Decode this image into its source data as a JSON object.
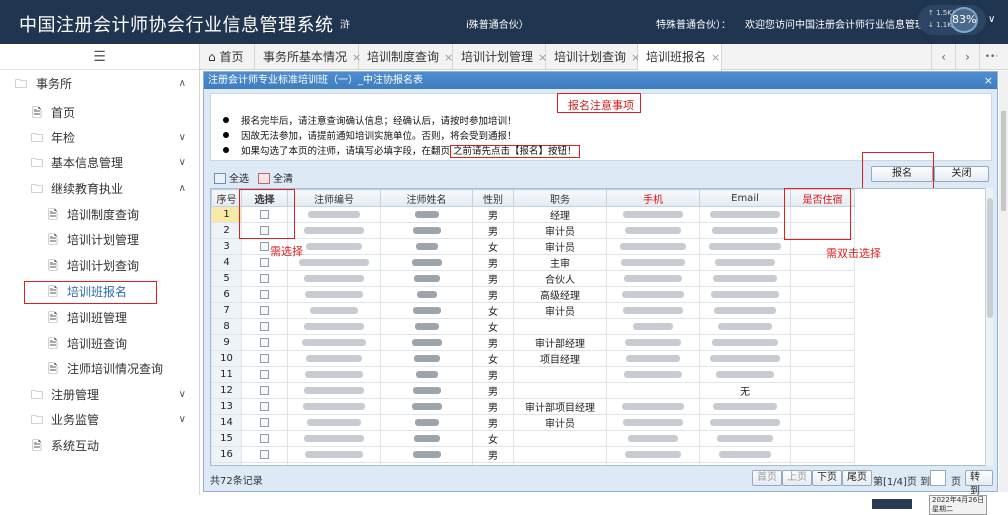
{
  "header": {
    "system_title": "中国注册会计师协会行业信息管理系统",
    "firm_a": "浒",
    "firm_b": "i殊普通合伙）",
    "firm_c": "特殊普通合伙）：",
    "welcome": "欢迎您访问中国注册会计师行业信息管理系统",
    "net_up": "↑ 1.5K/s",
    "net_down": "↓ 1.1K/s",
    "net_percent": "83%"
  },
  "sidebar": {
    "items": [
      {
        "label": "事务所",
        "level": 1,
        "icon": "folder-icon",
        "arrow": "∧"
      },
      {
        "label": "首页",
        "level": 2,
        "icon": "doc-icon",
        "arrow": ""
      },
      {
        "label": "年检",
        "level": 2,
        "icon": "folder-icon",
        "arrow": "∨"
      },
      {
        "label": "基本信息管理",
        "level": 2,
        "icon": "folder-icon",
        "arrow": "∨"
      },
      {
        "label": "继续教育执业",
        "level": 2,
        "icon": "folder-icon",
        "arrow": "∧"
      },
      {
        "label": "培训制度查询",
        "level": 3,
        "icon": "doc-icon",
        "arrow": ""
      },
      {
        "label": "培训计划管理",
        "level": 3,
        "icon": "doc-icon",
        "arrow": ""
      },
      {
        "label": "培训计划查询",
        "level": 3,
        "icon": "doc-icon",
        "arrow": ""
      },
      {
        "label": "培训班报名",
        "level": 3,
        "icon": "doc-icon",
        "arrow": "",
        "active": true
      },
      {
        "label": "培训班管理",
        "level": 3,
        "icon": "doc-icon",
        "arrow": ""
      },
      {
        "label": "培训班查询",
        "level": 3,
        "icon": "doc-icon",
        "arrow": ""
      },
      {
        "label": "注师培训情况查询",
        "level": 3,
        "icon": "doc-icon",
        "arrow": ""
      },
      {
        "label": "注册管理",
        "level": 2,
        "icon": "folder-icon",
        "arrow": "∨"
      },
      {
        "label": "业务监管",
        "level": 2,
        "icon": "folder-icon",
        "arrow": "∨"
      },
      {
        "label": "系统互动",
        "level": 2,
        "icon": "doc-icon",
        "arrow": ""
      }
    ]
  },
  "tabs": [
    {
      "label": "首页",
      "closable": false
    },
    {
      "label": "事务所基本情况",
      "closable": true
    },
    {
      "label": "培训制度查询",
      "closable": true
    },
    {
      "label": "培训计划管理",
      "closable": true
    },
    {
      "label": "培训计划查询",
      "closable": true
    },
    {
      "label": "培训班报名",
      "closable": true,
      "active": true
    }
  ],
  "tab_nav": {
    "prev": "‹",
    "next": "›",
    "more": "••·"
  },
  "dialog": {
    "title": "注册会计师专业标准培训班（一）_中注协报名表",
    "close": "×",
    "notice_title": "报名注意事项",
    "notice_lines": [
      "报名完毕后，请注意查询确认信息；经确认后，请按时参加培训！",
      "因故无法参加，请提前通知培训实施单位。否则，将会受到通报！",
      "如果勾选了本页的注师，请填写必填字段，在翻页之前请先点击【报名】按钮！"
    ],
    "notice_split": 22,
    "select_all": "全选",
    "clear_all": "全清",
    "signup_button": "报名",
    "close_button": "关闭"
  },
  "table": {
    "columns": [
      "序号",
      "选择",
      "注师编号",
      "注师姓名",
      "性别",
      "职务",
      "手机",
      "Email",
      "是否住宿"
    ],
    "rows": [
      {
        "no": "1",
        "gender": "男",
        "title": "经理",
        "email_text": ""
      },
      {
        "no": "2",
        "gender": "男",
        "title": "审计员",
        "email_text": ""
      },
      {
        "no": "3",
        "gender": "女",
        "title": "审计员",
        "email_text": ""
      },
      {
        "no": "4",
        "gender": "男",
        "title": "主审",
        "email_text": ""
      },
      {
        "no": "5",
        "gender": "男",
        "title": "合伙人",
        "email_text": ""
      },
      {
        "no": "6",
        "gender": "男",
        "title": "高级经理",
        "email_text": ""
      },
      {
        "no": "7",
        "gender": "女",
        "title": "审计员",
        "email_text": ""
      },
      {
        "no": "8",
        "gender": "女",
        "title": "",
        "email_text": ""
      },
      {
        "no": "9",
        "gender": "男",
        "title": "审计部经理",
        "email_text": ""
      },
      {
        "no": "10",
        "gender": "女",
        "title": "项目经理",
        "email_text": ""
      },
      {
        "no": "11",
        "gender": "男",
        "title": "",
        "email_text": ""
      },
      {
        "no": "12",
        "gender": "男",
        "title": "",
        "email_text": "无"
      },
      {
        "no": "13",
        "gender": "男",
        "title": "审计部项目经理",
        "email_text": ""
      },
      {
        "no": "14",
        "gender": "男",
        "title": "审计员",
        "email_text": ""
      },
      {
        "no": "15",
        "gender": "女",
        "title": "",
        "email_text": ""
      },
      {
        "no": "16",
        "gender": "男",
        "title": "",
        "email_text": ""
      },
      {
        "no": "17",
        "gender": "女",
        "title": "审计员",
        "email_text": ""
      }
    ]
  },
  "footer": {
    "total": "共72条记录",
    "first": "首页",
    "prev": "上页",
    "next": "下页",
    "last": "尾页",
    "page_info": "第[1/4]页 到",
    "page_suffix": "页",
    "goto": "转到"
  },
  "annotations": {
    "need_select": "需选择",
    "double_click": "需双击选择"
  },
  "taskbar": {
    "date": "2022年4月26日",
    "weekday": "星期二"
  }
}
